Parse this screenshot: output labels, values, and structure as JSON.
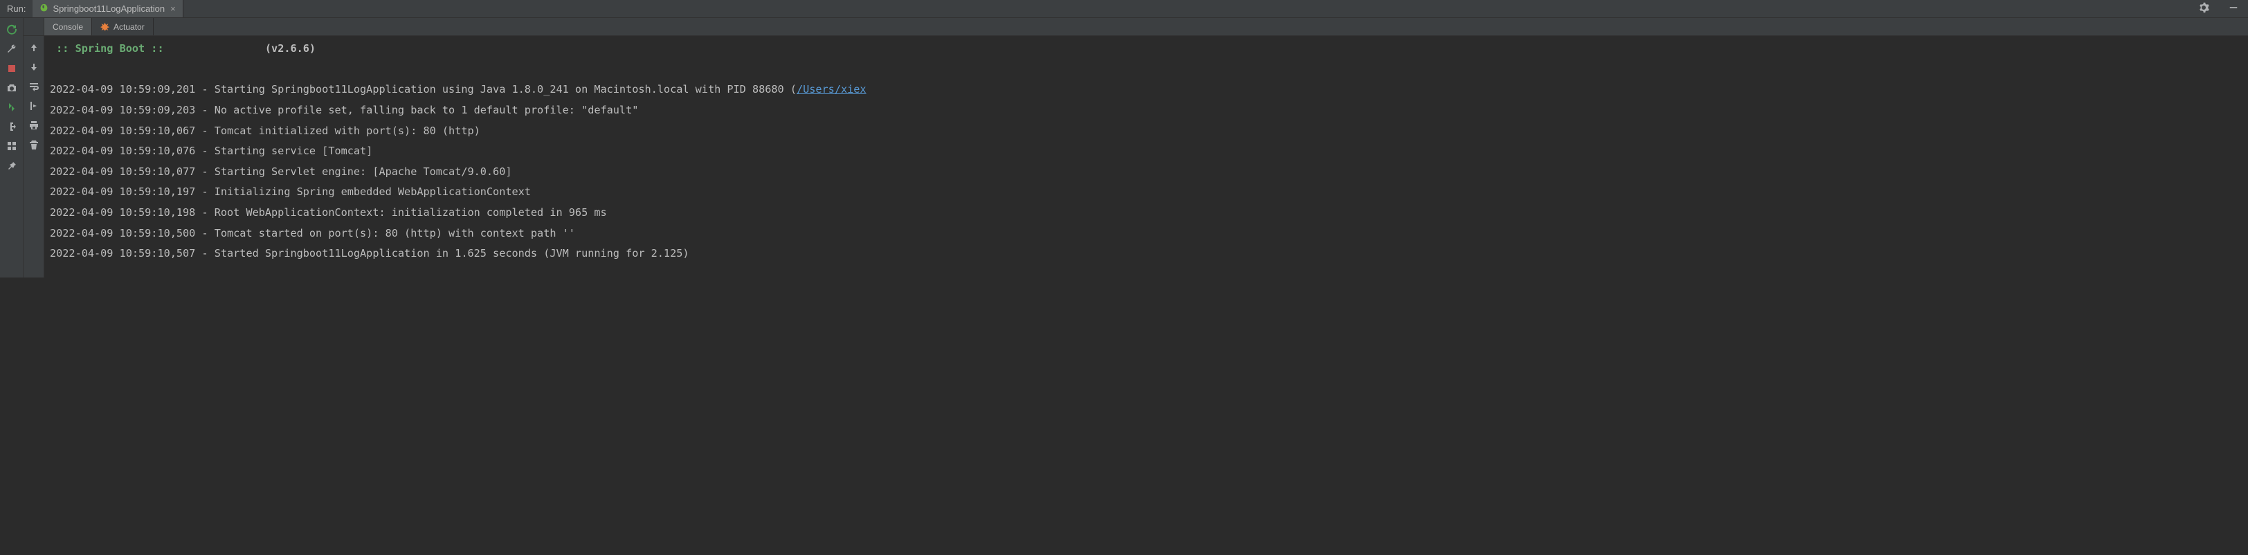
{
  "header": {
    "run_label": "Run:",
    "tab_name": "Springboot11LogApplication"
  },
  "sub_tabs": {
    "console": "Console",
    "actuator": "Actuator"
  },
  "banner": {
    "line": " :: Spring Boot ::",
    "version": "(v2.6.6)"
  },
  "log_lines": [
    {
      "ts": "2022-04-09 10:59:09,201",
      "msg": "Starting Springboot11LogApplication using Java 1.8.0_241 on Macintosh.local with PID 88680 (",
      "link": "/Users/xiex"
    },
    {
      "ts": "2022-04-09 10:59:09,203",
      "msg": "No active profile set, falling back to 1 default profile: \"default\""
    },
    {
      "ts": "2022-04-09 10:59:10,067",
      "msg": "Tomcat initialized with port(s): 80 (http)"
    },
    {
      "ts": "2022-04-09 10:59:10,076",
      "msg": "Starting service [Tomcat]"
    },
    {
      "ts": "2022-04-09 10:59:10,077",
      "msg": "Starting Servlet engine: [Apache Tomcat/9.0.60]"
    },
    {
      "ts": "2022-04-09 10:59:10,197",
      "msg": "Initializing Spring embedded WebApplicationContext"
    },
    {
      "ts": "2022-04-09 10:59:10,198",
      "msg": "Root WebApplicationContext: initialization completed in 965 ms"
    },
    {
      "ts": "2022-04-09 10:59:10,500",
      "msg": "Tomcat started on port(s): 80 (http) with context path ''"
    },
    {
      "ts": "2022-04-09 10:59:10,507",
      "msg": "Started Springboot11LogApplication in 1.625 seconds (JVM running for 2.125)"
    }
  ]
}
